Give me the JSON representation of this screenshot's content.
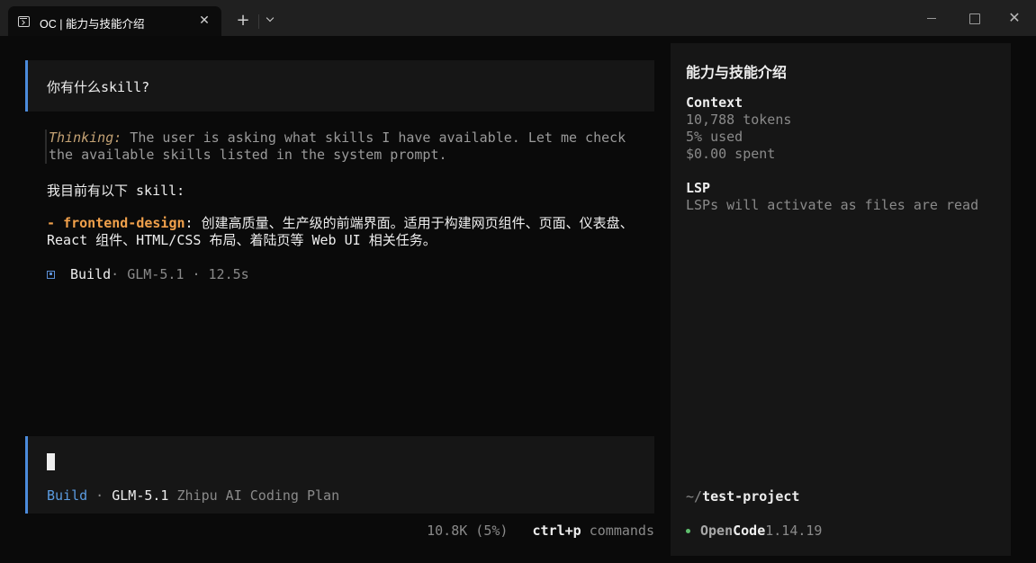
{
  "window": {
    "tab_title": "OC | 能力与技能介绍",
    "tab_close": "✕",
    "new_tab": "+",
    "close": "✕"
  },
  "conversation": {
    "user_message": "你有什么skill?",
    "thinking_label": "Thinking:",
    "thinking_text": " The user is asking what skills I have available. Let me check the available skills listed in the system prompt.",
    "reply_intro": "我目前有以下 skill:",
    "skill_prefix": "- ",
    "skill_name": "frontend-design",
    "skill_desc": ": 创建高质量、生产级的前端界面。适用于构建网页组件、页面、仪表盘、React 组件、HTML/CSS 布局、着陆页等 Web UI 相关任务。",
    "build": {
      "agent": "Build",
      "rest": " · GLM-5.1 · 12.5s"
    }
  },
  "prompt": {
    "agent": "Build",
    "sep": " · ",
    "model": "GLM-5.1",
    "provider": " Zhipu AI Coding Plan"
  },
  "footer": {
    "usage": "10.8K (5%)",
    "key": "ctrl+p",
    "key_label": " commands"
  },
  "sidebar": {
    "title": "能力与技能介绍",
    "context": {
      "heading": "Context",
      "tokens": "10,788 tokens",
      "used": "5% used",
      "spent": "$0.00 spent"
    },
    "lsp": {
      "heading": "LSP",
      "status": "LSPs will activate as files are read"
    },
    "path_prefix": "~/",
    "path_name": "test-project",
    "app_open": "Open",
    "app_code": "Code",
    "version": " 1.14.19"
  },
  "colors": {
    "accent_blue": "#4b8bdc",
    "skill_orange": "#f0a04b",
    "thinking_tan": "#c4a274",
    "status_green": "#5fbf6e"
  }
}
